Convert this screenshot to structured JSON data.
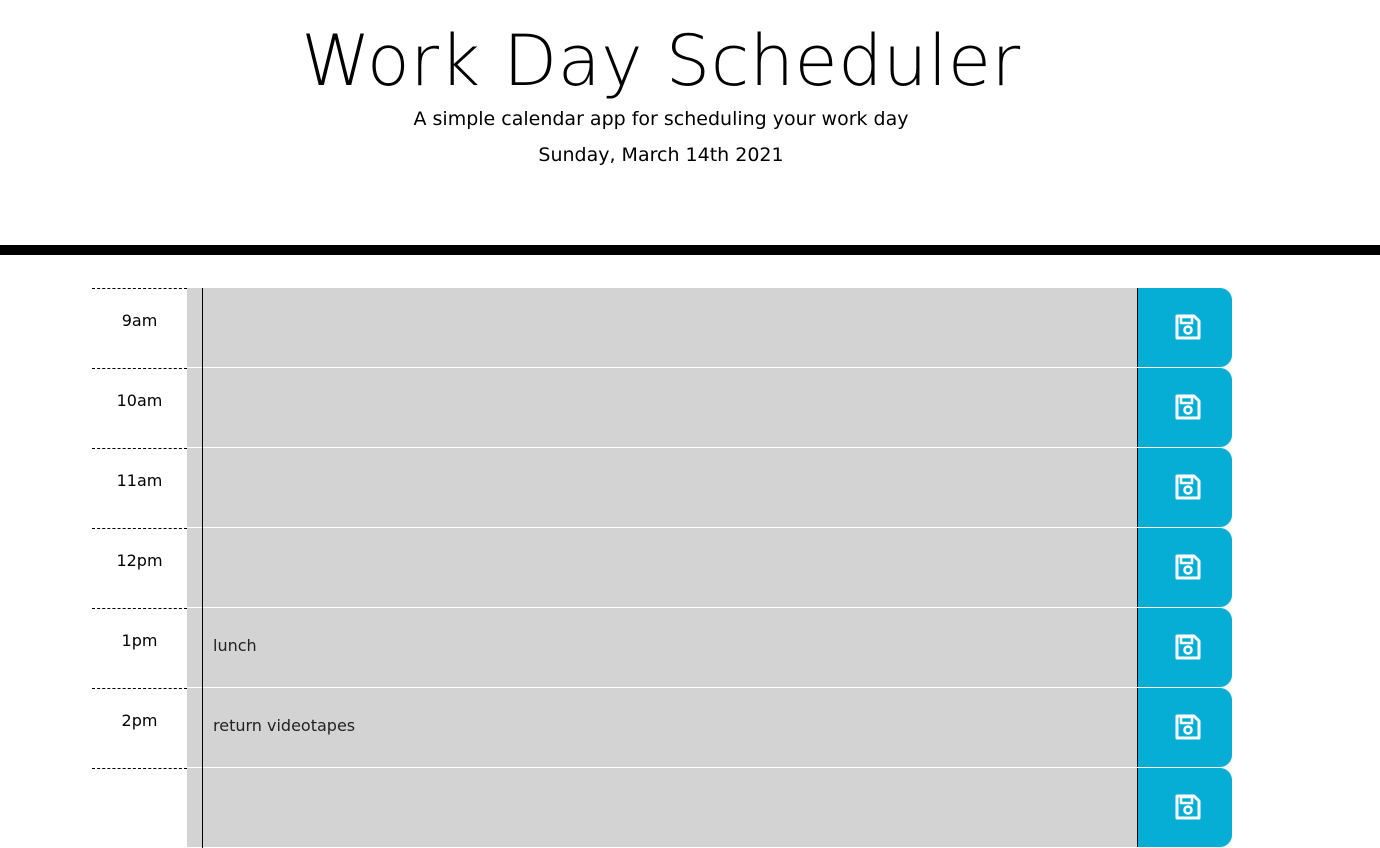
{
  "header": {
    "title": "Work Day Scheduler",
    "subtitle": "A simple calendar app for scheduling your work day",
    "current_date": "Sunday, March 14th 2021"
  },
  "colors": {
    "past": "#d3d3d3",
    "save_button": "#06aed5",
    "divider": "#000000"
  },
  "time_blocks": [
    {
      "hour": "9am",
      "text": "",
      "save_icon": "save-icon"
    },
    {
      "hour": "10am",
      "text": "",
      "save_icon": "save-icon"
    },
    {
      "hour": "11am",
      "text": "",
      "save_icon": "save-icon"
    },
    {
      "hour": "12pm",
      "text": "",
      "save_icon": "save-icon"
    },
    {
      "hour": "1pm",
      "text": "lunch",
      "save_icon": "save-icon"
    },
    {
      "hour": "2pm",
      "text": "return videotapes",
      "save_icon": "save-icon"
    },
    {
      "hour": "",
      "text": "",
      "save_icon": "save-icon"
    }
  ]
}
